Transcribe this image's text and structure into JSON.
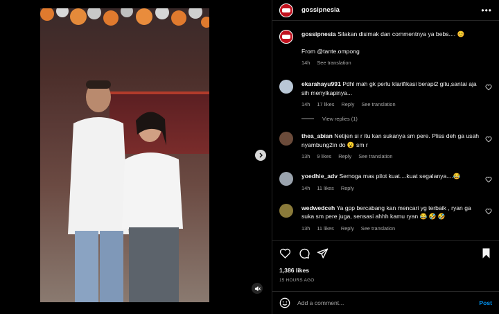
{
  "post": {
    "username": "gossipnesia",
    "caption": "Silakan disimak dan commentnya ya bebs.... 😊",
    "source": "From @tante.ompong",
    "time": "14h",
    "see_translation": "See translation"
  },
  "comments": [
    {
      "username": "ekarahayu991",
      "text": "Pdhl mah gk perlu klarifikasi berapi2 gitu,santai aja sih menyikapinya...",
      "time": "14h",
      "likes": "17 likes",
      "reply": "Reply",
      "translation": "See translation",
      "view_replies": "View replies (1)",
      "avatar_color": "#b9c7d6"
    },
    {
      "username": "thea_abian",
      "text": "Netijen si r itu kan sukanya sm pere. Pliss deh ga usah nyambung2in do 😮 sm r",
      "time": "13h",
      "likes": "9 likes",
      "reply": "Reply",
      "translation": "See translation",
      "avatar_color": "#6b4b3a"
    },
    {
      "username": "yoedhie_adv",
      "text": "Semoga mas pilot kuat....kuat segalanya....😂",
      "time": "14h",
      "likes": "11 likes",
      "reply": "Reply",
      "avatar_color": "#9aa3ad"
    },
    {
      "username": "wedwedceh",
      "text": "Ya gpp bercabang kan mencari yg terbaik , ryan ga suka sm pere juga, sensasi ahhh kamu ryan 😂 🤣 🤣",
      "time": "13h",
      "likes": "11 likes",
      "reply": "Reply",
      "translation": "See translation",
      "avatar_color": "#8a7a3a"
    }
  ],
  "stats": {
    "likes": "1,386 likes",
    "date": "15 HOURS AGO"
  },
  "add_comment": {
    "placeholder": "Add a comment...",
    "post_label": "Post"
  },
  "icons": {
    "more": "more-icon",
    "heart": "heart-icon",
    "comment": "comment-icon",
    "share": "share-icon",
    "save": "bookmark-icon",
    "emoji": "emoji-icon",
    "next": "chevron-right-icon",
    "mute": "mute-icon"
  },
  "colors": {
    "accent": "#0095f6",
    "brand": "#c1121f"
  }
}
